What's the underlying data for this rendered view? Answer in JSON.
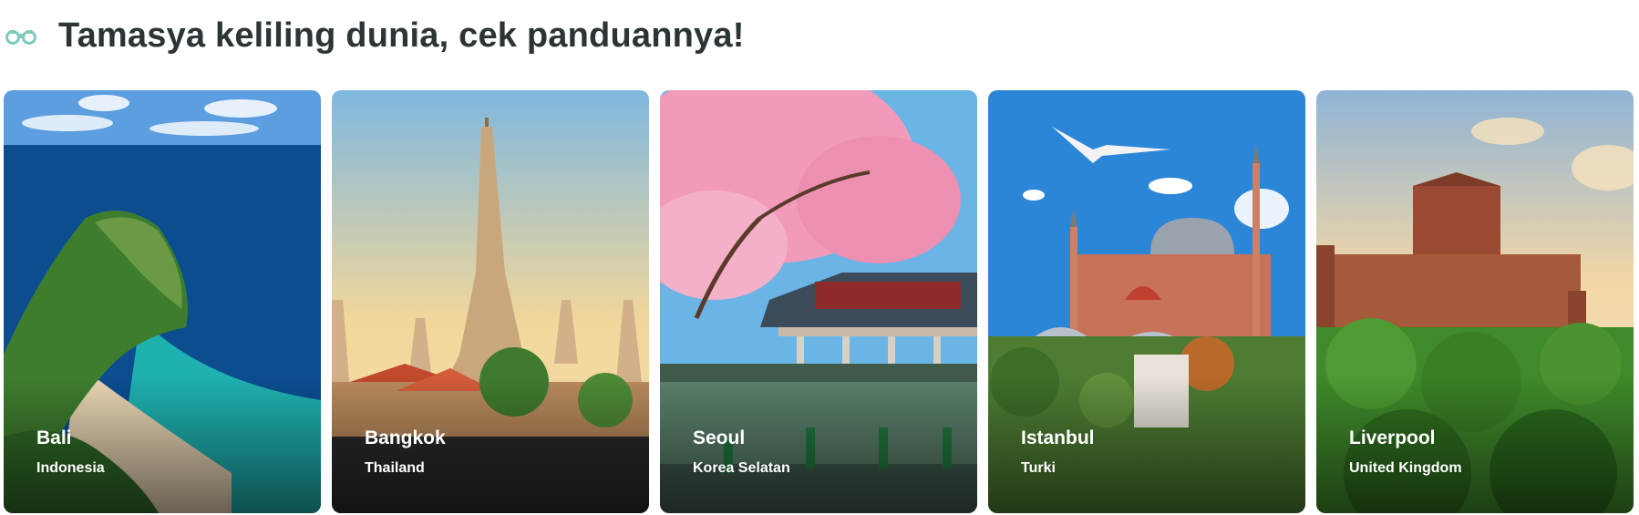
{
  "header": {
    "title": "Tamasya keliling dunia, cek panduannya!",
    "icon": "binoculars-icon",
    "icon_color": "#7fc9bd"
  },
  "destinations": [
    {
      "city": "Bali",
      "country": "Indonesia"
    },
    {
      "city": "Bangkok",
      "country": "Thailand"
    },
    {
      "city": "Seoul",
      "country": "Korea Selatan"
    },
    {
      "city": "Istanbul",
      "country": "Turki"
    },
    {
      "city": "Liverpool",
      "country": "United Kingdom"
    }
  ]
}
